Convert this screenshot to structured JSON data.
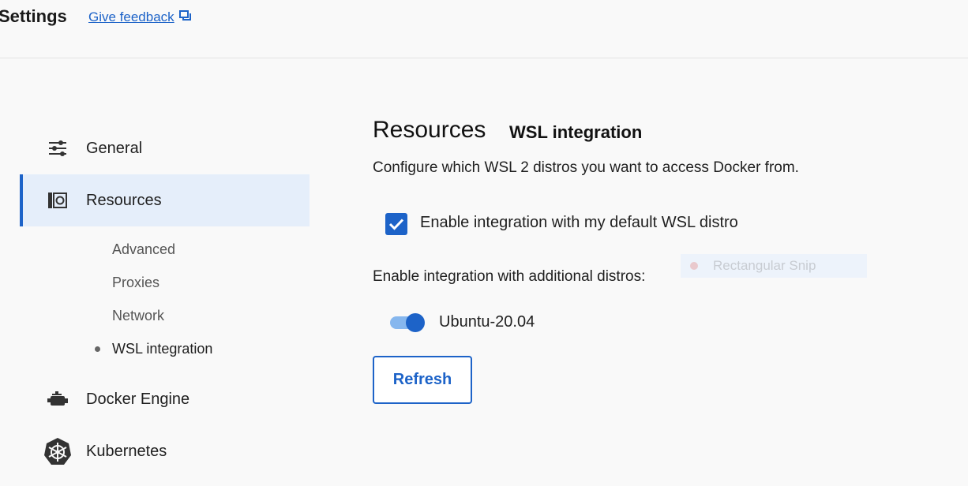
{
  "header": {
    "title": "Settings",
    "feedback_label": "Give feedback",
    "feedback_icon": "feedback-chat-icon"
  },
  "sidebar": {
    "items": [
      {
        "label": "General",
        "icon": "sliders-icon"
      },
      {
        "label": "Resources",
        "icon": "resources-icon",
        "active": true
      },
      {
        "label": "Docker Engine",
        "icon": "docker-engine-icon"
      },
      {
        "label": "Kubernetes",
        "icon": "kubernetes-icon"
      }
    ],
    "resources_subitems": [
      {
        "label": "Advanced"
      },
      {
        "label": "Proxies"
      },
      {
        "label": "Network"
      },
      {
        "label": "WSL integration",
        "current": true
      }
    ]
  },
  "main": {
    "title": "Resources",
    "subtitle": "WSL integration",
    "description": "Configure which WSL 2 distros you want to access Docker from.",
    "default_integration": {
      "label": "Enable integration with my default WSL distro",
      "checked": true
    },
    "additional_label": "Enable integration with additional distros:",
    "distros": [
      {
        "name": "Ubuntu-20.04",
        "enabled": true
      }
    ],
    "refresh_label": "Refresh"
  },
  "overlay": {
    "snip_label": "Rectangular Snip"
  },
  "colors": {
    "accent": "#1d63c8",
    "active_nav_bg": "#e5eefa",
    "background": "#f9f9f9"
  }
}
